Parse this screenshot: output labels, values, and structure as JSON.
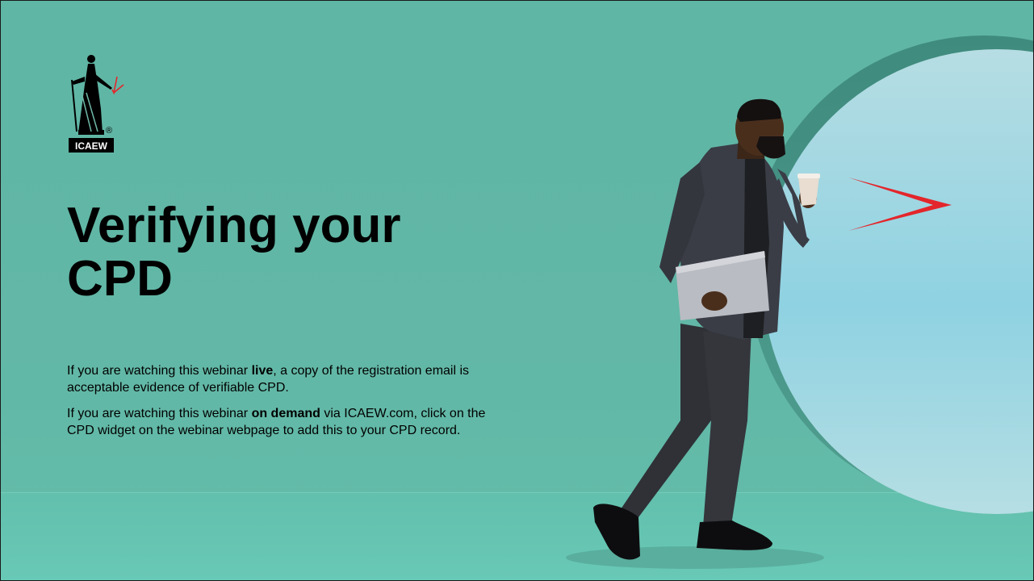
{
  "logo": {
    "text": "ICAEW",
    "registered_mark": "®",
    "accent_color": "#e3262b"
  },
  "title": {
    "line1": "Verifying your",
    "line2": "CPD"
  },
  "paragraph1": {
    "before": "If you are watching this webinar ",
    "bold": "live",
    "after": ", a copy of the registration email is acceptable evidence of verifiable CPD."
  },
  "paragraph2": {
    "before": "If you are watching this webinar ",
    "bold": "on demand",
    "after": " via ICAEW.com, click on the CPD widget on the webinar webpage to add this to your CPD record."
  },
  "colors": {
    "background": "#5fb6a4",
    "portal": "#a8d8e2",
    "accent": "#e3262b"
  }
}
